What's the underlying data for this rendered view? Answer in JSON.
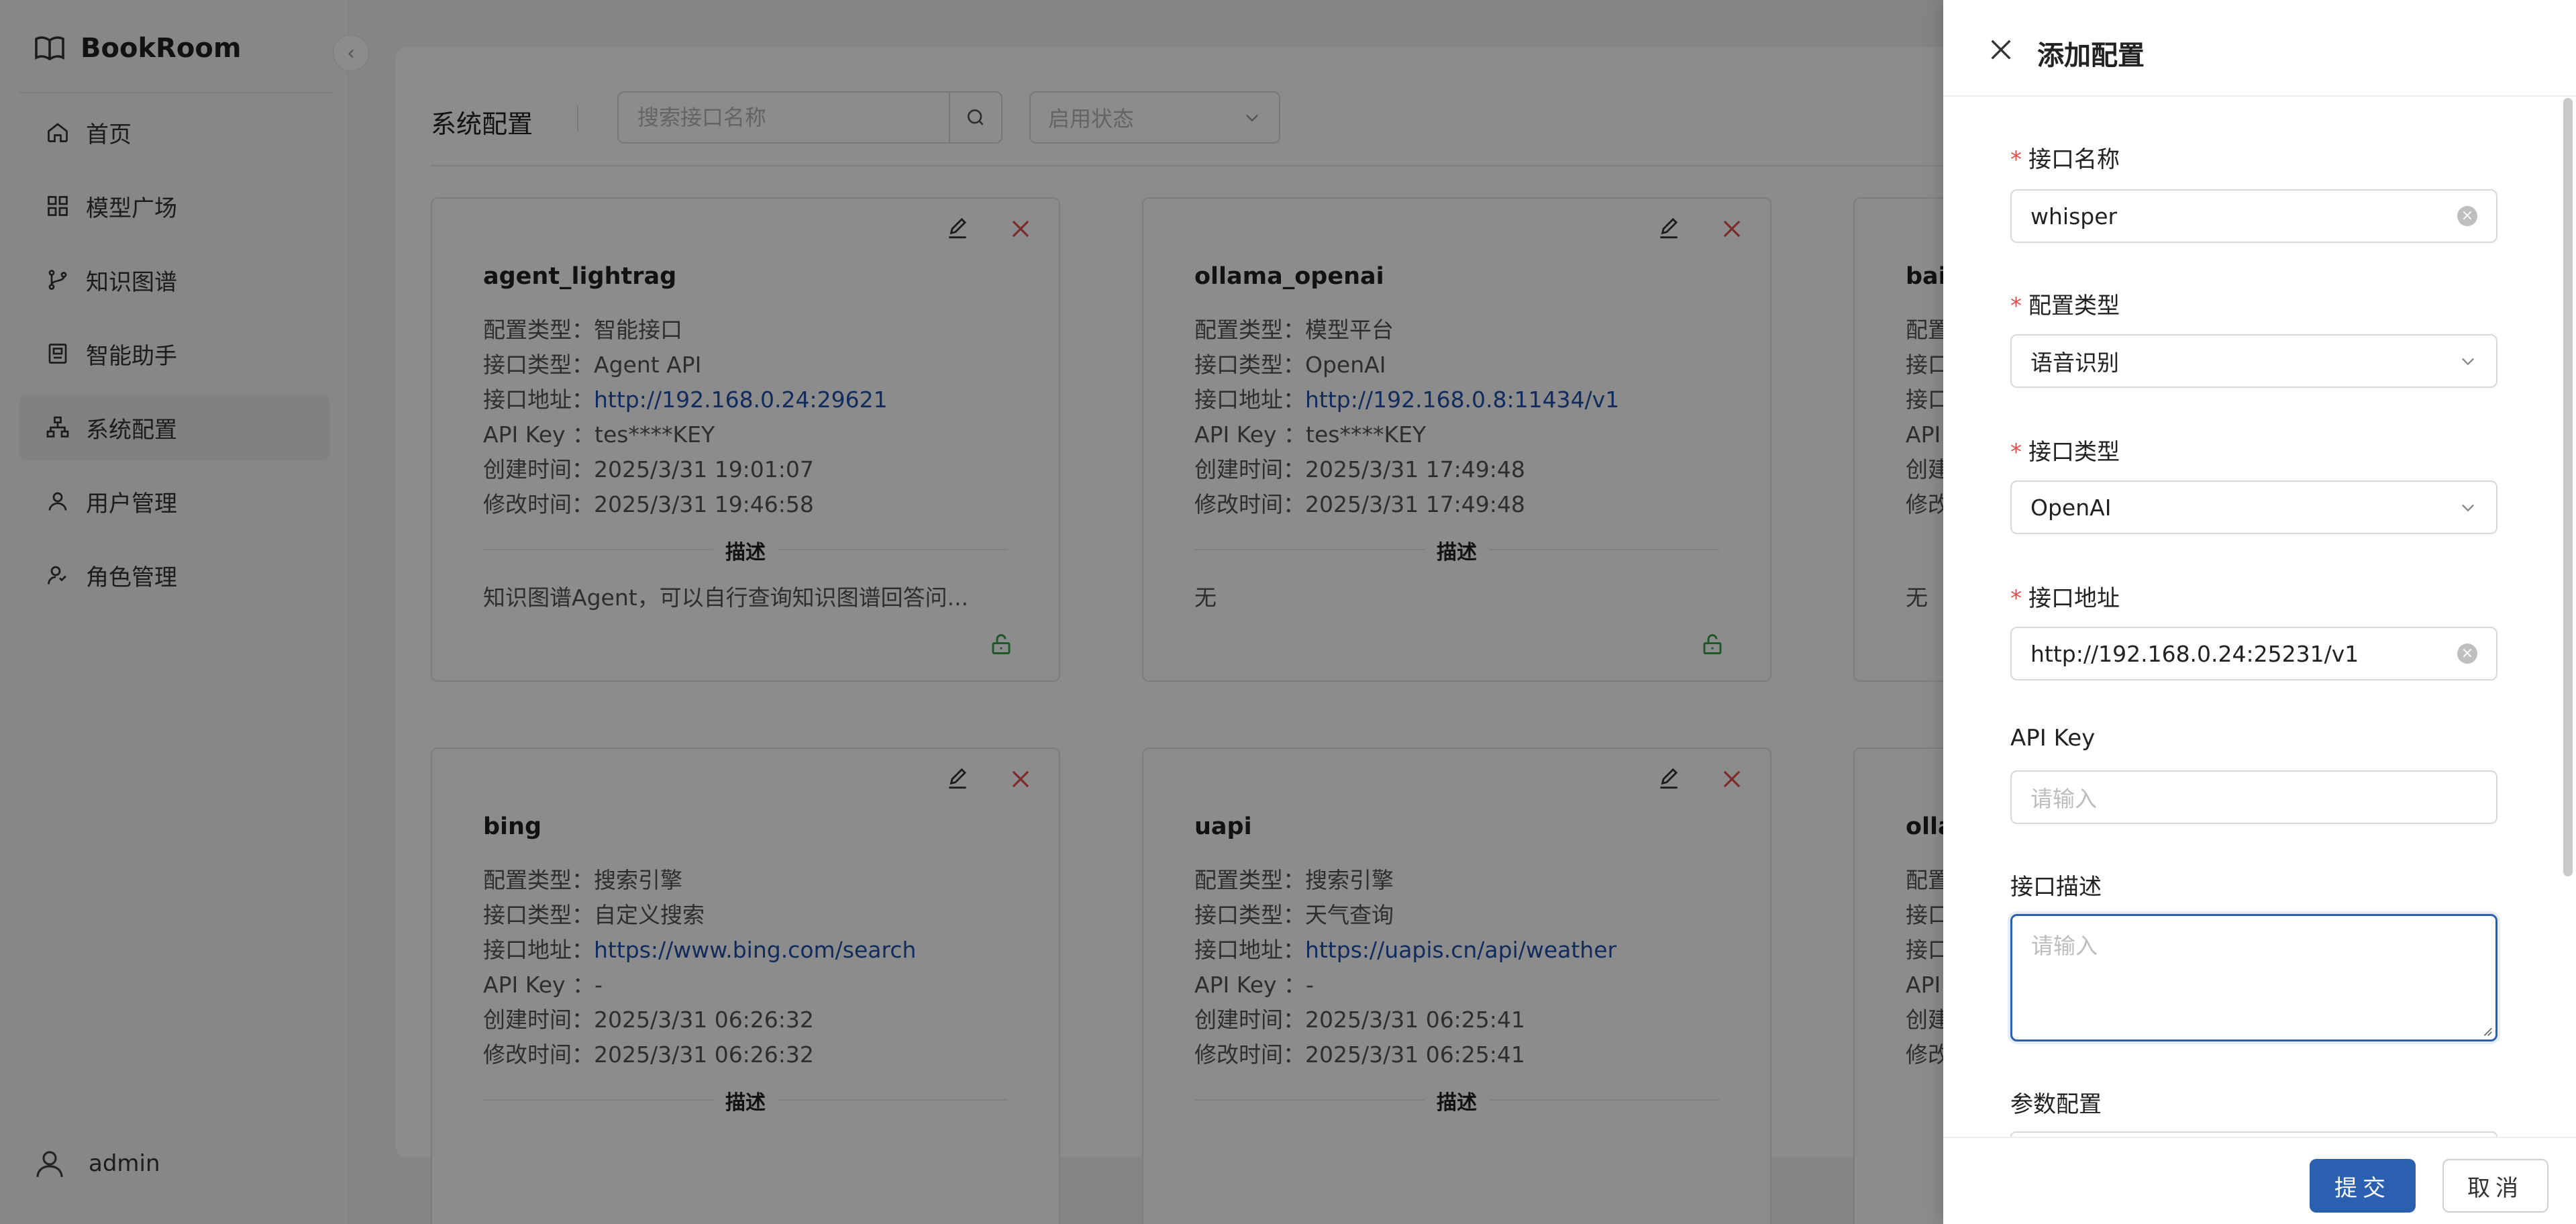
{
  "app": {
    "brand": "BookRoom",
    "nav": [
      {
        "label": "首页",
        "icon": "home-icon"
      },
      {
        "label": "模型广场",
        "icon": "grid-icon"
      },
      {
        "label": "知识图谱",
        "icon": "branch-icon"
      },
      {
        "label": "智能助手",
        "icon": "assistant-icon"
      },
      {
        "label": "系统配置",
        "icon": "sitemap-icon",
        "active": true
      },
      {
        "label": "用户管理",
        "icon": "user-icon"
      },
      {
        "label": "角色管理",
        "icon": "role-icon"
      }
    ],
    "user": "admin"
  },
  "page": {
    "title": "系统配置",
    "search_placeholder": "搜索接口名称",
    "status_placeholder": "启用状态"
  },
  "card_labels": {
    "config_type": "配置类型：",
    "api_type": "接口类型：",
    "api_url": "接口地址：",
    "api_key": "API  Key ：",
    "created": "创建时间：",
    "modified": "修改时间：",
    "desc_title": "描述"
  },
  "cards": [
    {
      "name": "agent_lightrag",
      "config_type": "智能接口",
      "api_type": "Agent API",
      "url": "http://192.168.0.24:29621",
      "api_key": "tes****KEY",
      "created": "2025/3/31 19:01:07",
      "modified": "2025/3/31 19:46:58",
      "desc": "知识图谱Agent，可以自行查询知识图谱回答问..."
    },
    {
      "name": "ollama_openai",
      "config_type": "模型平台",
      "api_type": "OpenAI",
      "url": "http://192.168.0.8:11434/v1",
      "api_key": "tes****KEY",
      "created": "2025/3/31 17:49:48",
      "modified": "2025/3/31 17:49:48",
      "desc": "无"
    },
    {
      "name": "bai",
      "config_type": "配置",
      "api_type": "接口",
      "url": "接口",
      "api_key": "API",
      "created": "创建",
      "modified": "修改",
      "desc": "无"
    },
    {
      "name": "bing",
      "config_type": "搜索引擎",
      "api_type": "自定义搜索",
      "url": "https://www.bing.com/search",
      "api_key": "-",
      "created": "2025/3/31 06:26:32",
      "modified": "2025/3/31 06:26:32"
    },
    {
      "name": "uapi",
      "config_type": "搜索引擎",
      "api_type": "天气查询",
      "url": "https://uapis.cn/api/weather",
      "api_key": "-",
      "created": "2025/3/31 06:25:41",
      "modified": "2025/3/31 06:25:41"
    },
    {
      "name": "olla",
      "config_type": "配置",
      "api_type": "接口",
      "url": "接口",
      "api_key": "API",
      "created": "创建",
      "modified": "修改"
    }
  ],
  "drawer": {
    "title": "添加配置",
    "fields": {
      "name": {
        "label": "接口名称",
        "value": "whisper"
      },
      "config_type": {
        "label": "配置类型",
        "value": "语音识别"
      },
      "api_type": {
        "label": "接口类型",
        "value": "OpenAI"
      },
      "url": {
        "label": "接口地址",
        "value": "http://192.168.0.24:25231/v1"
      },
      "api_key": {
        "label": "API Key",
        "placeholder": "请输入"
      },
      "desc": {
        "label": "接口描述",
        "placeholder": "请输入"
      },
      "params": {
        "label": "参数配置"
      }
    },
    "submit": "提交",
    "cancel": "取消"
  },
  "colors": {
    "primary": "#2b5fb0",
    "danger": "#e34d4d",
    "success": "#3aa14b",
    "link": "#1f4fa8"
  }
}
